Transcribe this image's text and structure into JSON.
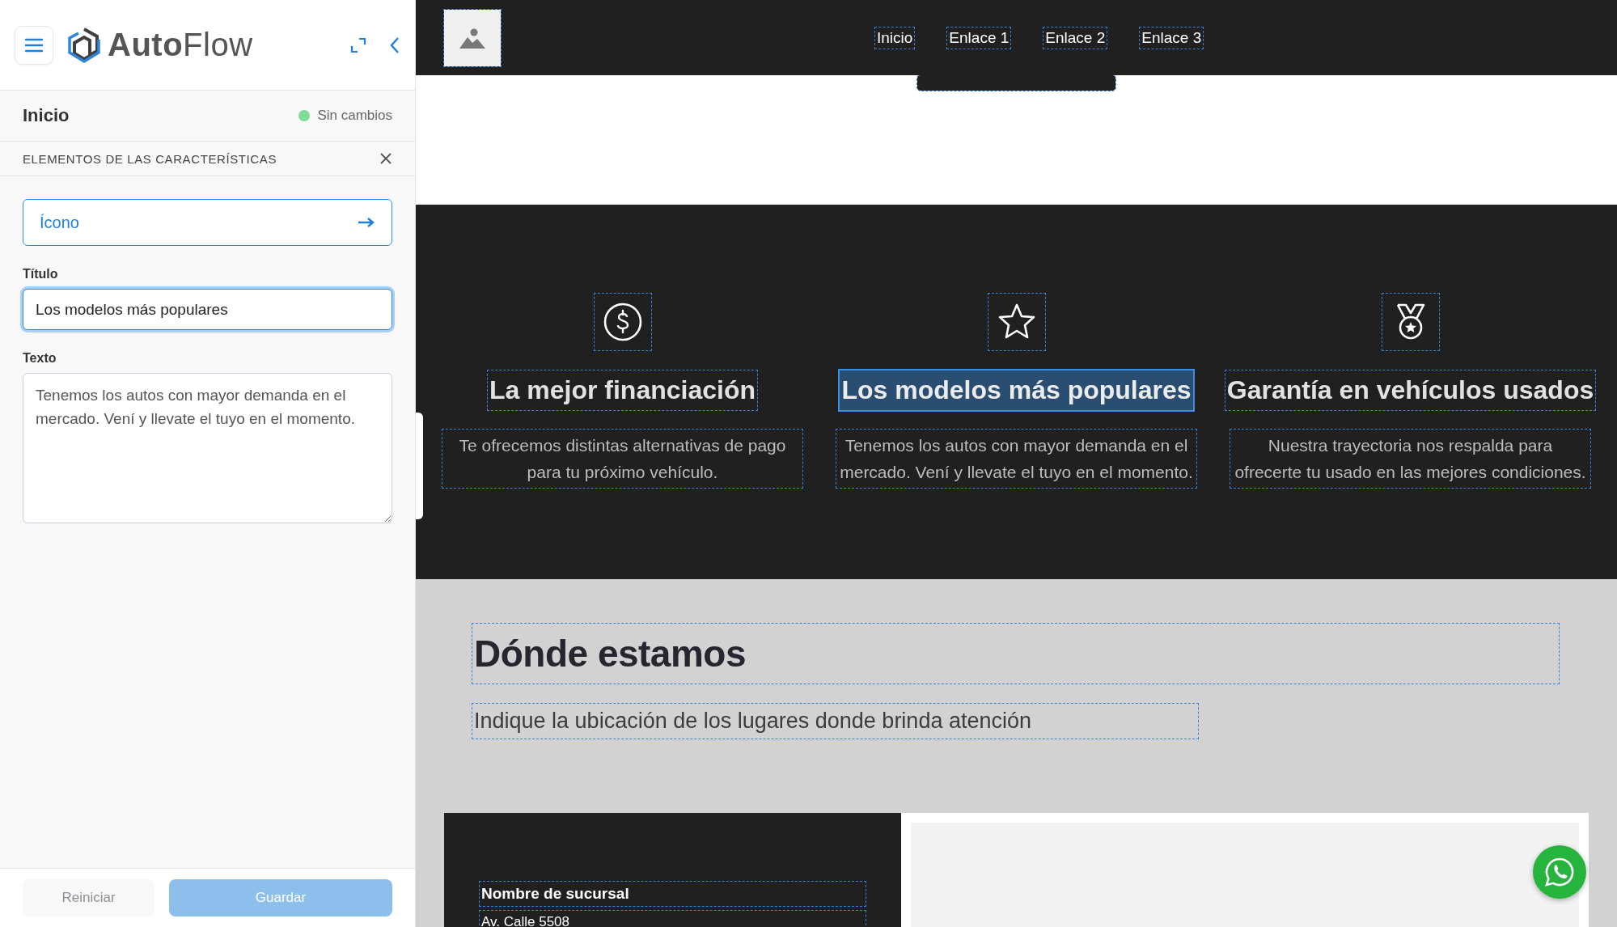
{
  "sidebar": {
    "brand": "**Auto**Flow",
    "page_title": "Inicio",
    "status": {
      "label": "Sin cambios",
      "changed": false
    },
    "section_title": "ELEMENTOS DE LAS CARACTERÍSTICAS",
    "icon_field": {
      "label": "Ícono"
    },
    "fields": [
      {
        "kind": "input",
        "label": "Título",
        "value": "Los modelos más populares",
        "focused": true
      },
      {
        "kind": "textarea",
        "label": "Texto",
        "value": "Tenemos los autos con mayor demanda en el mercado. Vení y llevate el tuyo en el momento.",
        "focused": false
      }
    ],
    "buttons": [
      {
        "label": "Reiniciar",
        "kind": "secondary",
        "disabled": true
      },
      {
        "label": "Guardar",
        "kind": "primary",
        "disabled": true
      }
    ]
  },
  "preview": {
    "nav_links": [
      {
        "label": "Inicio"
      },
      {
        "label": "Enlace 1"
      },
      {
        "label": "Enlace 2"
      },
      {
        "label": "Enlace 3"
      }
    ],
    "features": [
      {
        "kind": "dollar",
        "title": "La mejor financiación",
        "text": "Te ofrecemos distintas alternativas de pago\npara tu próximo vehículo.",
        "selected": false
      },
      {
        "kind": "star",
        "title": "Los modelos más populares",
        "text": "Tenemos los autos con mayor demanda en el\nmercado. Vení y llevate el tuyo en el momento.",
        "selected": true
      },
      {
        "kind": "medal",
        "title": "Garantía en vehículos usados",
        "text": "Nuestra trayectoria nos respalda para\nofrecerte tu usado en las mejores condiciones.",
        "selected": false
      }
    ],
    "location": {
      "title": "Dónde estamos",
      "subtitle": "Indique la ubicación de los lugares donde brinda atención",
      "branch": {
        "name": "Nombre de sucursal",
        "address": "Av. Calle 5508"
      }
    }
  }
}
